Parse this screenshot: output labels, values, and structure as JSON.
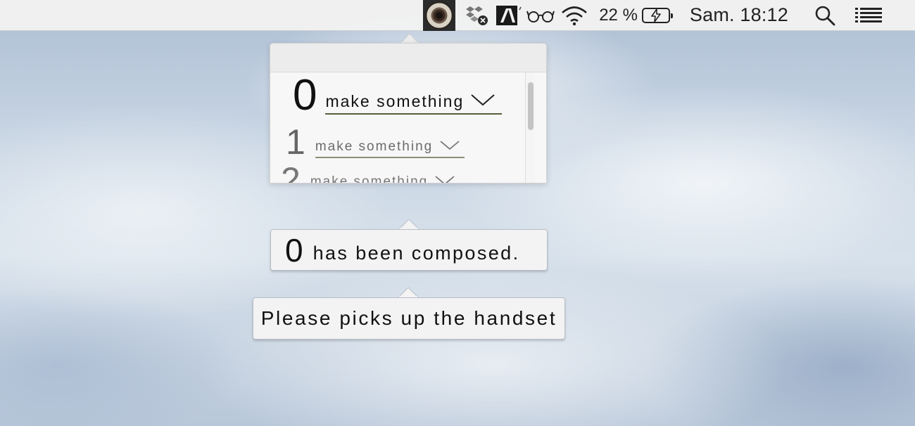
{
  "menubar": {
    "app_icon": "rotary-dial-icon",
    "status_icons": [
      "dropbox-icon",
      "adobe-icon",
      "glasses-icon",
      "wifi-icon"
    ],
    "battery_percent": "22 %",
    "battery_charging": true,
    "clock": "Sam. 18:12",
    "search_icon": "search-icon",
    "menu_icon": "list-icon"
  },
  "dial_list": {
    "rows": [
      {
        "digit": "0",
        "label": "make something"
      },
      {
        "digit": "1",
        "label": "make something"
      },
      {
        "digit": "2",
        "label": "make something"
      }
    ]
  },
  "composed_bubble": {
    "digit": "0",
    "message": "has been composed."
  },
  "handset_bubble": {
    "message": "Please picks up the handset"
  },
  "colors": {
    "underline_active": "#55603a",
    "underline_inactive": "#8a8e76"
  }
}
